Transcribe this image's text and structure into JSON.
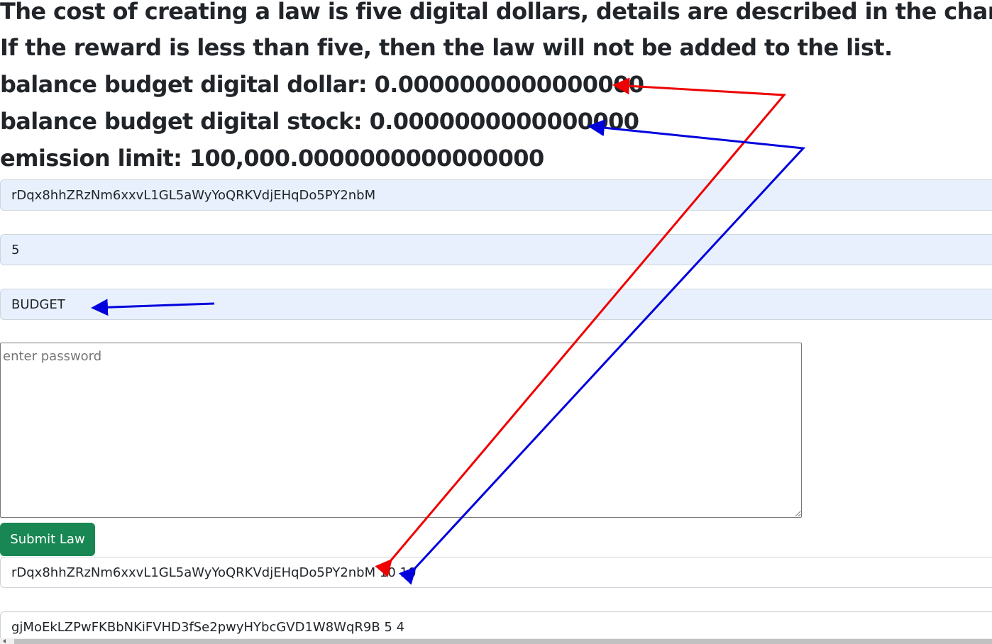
{
  "info": {
    "line1": "The cost of creating a law is five digital dollars, details are described in the charter.",
    "line2": "If the reward is less than five, then the law will not be added to the list.",
    "balance_dollar": "balance budget digital dollar: 0.0000000000000000",
    "balance_stock": "balance budget digital stock: 0.0000000000000000",
    "emission_limit": "emission limit: 100,000.0000000000000000"
  },
  "form": {
    "address_value": "rDqx8hhZRzNm6xxvL1GL5aWyYoQRKVdjEHqDo5PY2nbM",
    "reward_value": "5",
    "law_name_value": "BUDGET",
    "password_placeholder": "enter password",
    "submit_label": "Submit Law"
  },
  "laws": [
    "rDqx8hhZRzNm6xxvL1GL5aWyYoQRKVdjEHqDo5PY2nbM 10 10",
    "gjMoEkLZPwFKBbNKiFVHD3fSe2pwyHYbcGVD1W8WqR9B 5 4"
  ],
  "colors": {
    "red_arrow": "#ee0000",
    "blue_arrow": "#0000dd",
    "submit_button": "#198754",
    "autofill_field": "#e8f0fe"
  }
}
